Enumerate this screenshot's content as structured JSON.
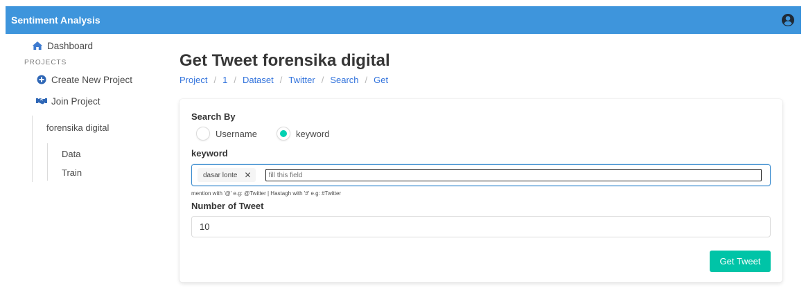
{
  "navbar": {
    "brand": "Sentiment Analysis",
    "user_icon": "user-circle-icon"
  },
  "sidebar": {
    "dashboard": "Dashboard",
    "projects_label": "PROJECTS",
    "create_project": "Create New Project",
    "join_project": "Join Project",
    "project_name": "forensika digital",
    "sub_items": [
      "Data",
      "Train"
    ]
  },
  "main": {
    "title": "Get Tweet forensika digital",
    "breadcrumb": [
      "Project",
      "1",
      "Dataset",
      "Twitter",
      "Search",
      "Get"
    ]
  },
  "form": {
    "search_by_label": "Search By",
    "options": [
      {
        "label": "Username",
        "selected": false
      },
      {
        "label": "keyword",
        "selected": true
      }
    ],
    "keyword_label": "keyword",
    "tags": [
      "dasar lonte"
    ],
    "tag_placeholder": "fill this field",
    "help_text": "mention with '@' e.g: @Twitter | Hastagh with '#' e.g: #Twitter",
    "number_label": "Number of Tweet",
    "number_value": "10",
    "submit_label": "Get Tweet"
  },
  "colors": {
    "navbar": "#3e95dc",
    "accent": "#00c4a7",
    "link": "#3273dc"
  }
}
